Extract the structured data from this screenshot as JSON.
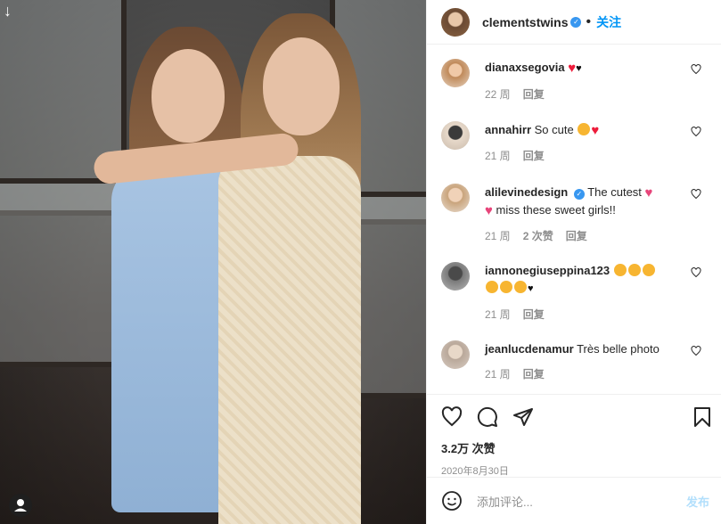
{
  "post": {
    "username": "clementstwins",
    "follow_label": "关注",
    "likes": "3.2万 次赞",
    "date": "2020年8月30日"
  },
  "comments": [
    {
      "user": "dianaxsegovia",
      "text": "",
      "time": "22 周",
      "likes": "",
      "reply": "回复",
      "emoji": [
        "red-heart",
        "black-heart"
      ]
    },
    {
      "user": "annahirr",
      "text": "So cute",
      "time": "21 周",
      "likes": "",
      "reply": "回复",
      "emoji": [
        "heart-eyes",
        "red-heart"
      ]
    },
    {
      "user": "alilevinedesign",
      "verified": true,
      "text": "The cutest",
      "text2": "miss these sweet girls!!",
      "time": "21 周",
      "likes": "2 次赞",
      "reply": "回复",
      "emoji": [
        "sparkling-heart"
      ]
    },
    {
      "user": "iannonegiuseppina123",
      "text": "",
      "time": "21 周",
      "likes": "",
      "reply": "回复",
      "emoji": [
        "smiling-hearts",
        "smiling-hearts",
        "smiling-hearts",
        "smiling-hearts",
        "smiling-hearts",
        "smiling-hearts",
        "black-heart"
      ]
    },
    {
      "user": "jeanlucdenamur",
      "text": "Très belle photo",
      "time": "21 周",
      "likes": "",
      "reply": "回复",
      "emoji": []
    }
  ],
  "add_comment": {
    "placeholder": "添加评论...",
    "post_label": "发布"
  },
  "icons": [
    "like-icon",
    "comment-icon",
    "share-icon",
    "bookmark-icon",
    "emoji-icon"
  ],
  "colors": {
    "accent": "#0095f6",
    "verified": "#3897f0",
    "heart": "#ed1c3b"
  }
}
